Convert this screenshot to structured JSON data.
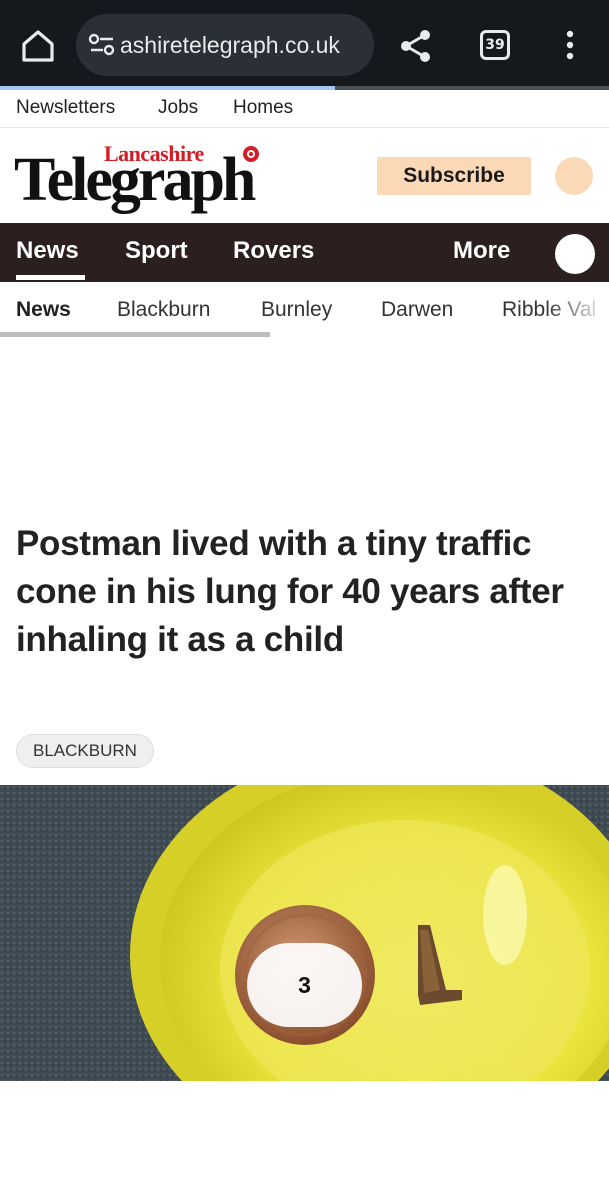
{
  "browser": {
    "url": "ashiretelegraph.co.uk",
    "tab_count": "39",
    "load_progress": 0.55,
    "icons": [
      "home-icon",
      "site-settings-icon",
      "share-icon",
      "tab-switcher-icon",
      "more-vert-icon"
    ]
  },
  "utility_links": [
    "Newsletters",
    "Jobs",
    "Homes"
  ],
  "masthead": {
    "logo_top": "Lancashire",
    "logo_main": "Telegraph",
    "subscribe_label": "Subscribe",
    "accent_color": "#fcd9b6",
    "brand_red": "#d51b23"
  },
  "main_nav": {
    "items": [
      "News",
      "Sport",
      "Rovers"
    ],
    "more_label": "More",
    "active": "News",
    "background": "#2b1f1f"
  },
  "sub_nav": {
    "items": [
      "News",
      "Blackburn",
      "Burnley",
      "Darwen",
      "Ribble Val"
    ],
    "active": "News"
  },
  "article": {
    "headline": "Postman lived with a tiny traffic cone in his lung for 40 years after inhaling it as a child",
    "tag": "BLACKBURN",
    "gallery_count": "3"
  }
}
